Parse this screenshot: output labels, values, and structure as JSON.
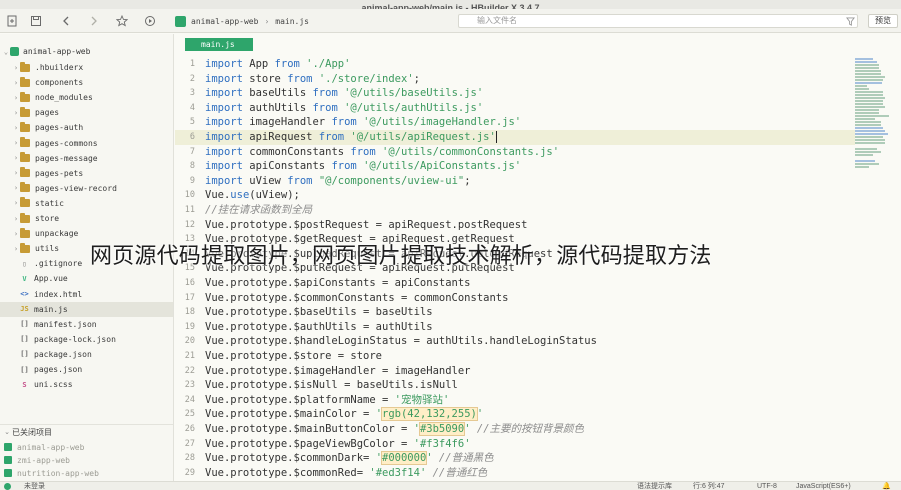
{
  "window": {
    "title": "animal-app-web/main.js - HBuilder X 3.4.7"
  },
  "toolbar": {
    "breadcrumb": [
      "animal-app-web",
      "main.js"
    ],
    "search_placeholder": "输入文件名",
    "preview_label": "预览"
  },
  "sidebar": {
    "project": "animal-app-web",
    "items": [
      {
        "label": ".hbuilderx",
        "type": "folder"
      },
      {
        "label": "components",
        "type": "folder"
      },
      {
        "label": "node_modules",
        "type": "folder"
      },
      {
        "label": "pages",
        "type": "folder"
      },
      {
        "label": "pages-auth",
        "type": "folder"
      },
      {
        "label": "pages-commons",
        "type": "folder"
      },
      {
        "label": "pages-message",
        "type": "folder"
      },
      {
        "label": "pages-pets",
        "type": "folder"
      },
      {
        "label": "pages-view-record",
        "type": "folder"
      },
      {
        "label": "static",
        "type": "folder"
      },
      {
        "label": "store",
        "type": "folder"
      },
      {
        "label": "unpackage",
        "type": "folder"
      },
      {
        "label": "utils",
        "type": "folder"
      },
      {
        "label": ".gitignore",
        "type": "file"
      },
      {
        "label": "App.vue",
        "type": "vue"
      },
      {
        "label": "index.html",
        "type": "html"
      },
      {
        "label": "main.js",
        "type": "js"
      },
      {
        "label": "manifest.json",
        "type": "json"
      },
      {
        "label": "package-lock.json",
        "type": "json"
      },
      {
        "label": "package.json",
        "type": "json"
      },
      {
        "label": "pages.json",
        "type": "json"
      },
      {
        "label": "uni.scss",
        "type": "scss"
      }
    ],
    "closed_header": "已关闭项目",
    "closed_projects": [
      "animal-app-web",
      "zmi-app-web",
      "nutrition-app-web"
    ]
  },
  "editor": {
    "tab": "main.js",
    "current_line": 6,
    "line_numbers": [
      "1",
      "2",
      "3",
      "4",
      "5",
      "6",
      "7",
      "8",
      "9",
      "10",
      "11",
      "12",
      "13",
      "14",
      "15",
      "16",
      "17",
      "18",
      "19",
      "20",
      "21",
      "22",
      "23",
      "24",
      "25",
      "26",
      "27",
      "28",
      "29"
    ]
  },
  "code": {
    "l1": {
      "kw1": "import",
      "name": " App ",
      "kw2": "from",
      "str": " './App'"
    },
    "l2": {
      "kw1": "import",
      "name": " store ",
      "kw2": "from",
      "str": " './store/index'",
      "end": ";"
    },
    "l3": {
      "kw1": "import",
      "name": " baseUtils ",
      "kw2": "from",
      "str": " '@/utils/baseUtils.js'"
    },
    "l4": {
      "kw1": "import",
      "name": " authUtils ",
      "kw2": "from",
      "str": " '@/utils/authUtils.js'"
    },
    "l5": {
      "kw1": "import",
      "name": " imageHandler ",
      "kw2": "from",
      "str": " '@/utils/imageHandler.js'"
    },
    "l6": {
      "kw1": "import",
      "name": " apiRequest ",
      "kw2": "from",
      "str": " '@/utils/apiRequest.js'"
    },
    "l7": {
      "kw1": "import",
      "name": " commonConstants ",
      "kw2": "from",
      "str": " '@/utils/commonConstants.js'"
    },
    "l8": {
      "kw1": "import",
      "name": " apiConstants ",
      "kw2": "from",
      "str": " '@/utils/ApiConstants.js'"
    },
    "l9": {
      "kw1": "import",
      "name": " uView ",
      "kw2": "from",
      "str": " \"@/components/uview-ui\"",
      "end": ";"
    },
    "l10": {
      "a": "Vue.",
      "kw": "use",
      "b": "(uView);"
    },
    "l11": {
      "comment": "//挂在请求函数到全局"
    },
    "l12": {
      "a": "Vue.prototype.$postRequest = apiRequest.postRequest"
    },
    "l13": {
      "a": "Vue.prototype.$getRequest = apiRequest.getRequest"
    },
    "l14": {
      "a": "Vue.prototype.$uploadRequest = apiRequest.uploadRequest"
    },
    "l15": {
      "a": "Vue.prototype.$putRequest = apiRequest.putRequest"
    },
    "l16": {
      "a": "Vue.prototype.$apiConstants = apiConstants"
    },
    "l17": {
      "a": "Vue.prototype.$commonConstants = commonConstants"
    },
    "l18": {
      "a": "Vue.prototype.$baseUtils = baseUtils"
    },
    "l19": {
      "a": "Vue.prototype.$authUtils = authUtils"
    },
    "l20": {
      "a": "Vue.prototype.$handleLoginStatus = authUtils.handleLoginStatus"
    },
    "l21": {
      "a": "Vue.prototype.$store = store"
    },
    "l22": {
      "a": "Vue.prototype.$imageHandler = imageHandler"
    },
    "l23": {
      "a": "Vue.prototype.$isNull = baseUtils.isNull"
    },
    "l24": {
      "a": "Vue.prototype.$platformName = ",
      "str": "'宠物驿站'"
    },
    "l25": {
      "a": "Vue.prototype.$mainColor = ",
      "q1": "'",
      "val": "rgb(42,132,255)",
      "q2": "'"
    },
    "l26": {
      "a": "Vue.prototype.$mainButtonColor = ",
      "q1": "'",
      "val": "#3b5090",
      "q2": "'",
      "comment": " //主要的按钮背景颜色"
    },
    "l27": {
      "a": "Vue.prototype.$pageViewBgColor = ",
      "str": "'#f3f4f6'"
    },
    "l28": {
      "a": "Vue.prototype.$commonDark= ",
      "q1": "'",
      "val": "#000000",
      "q2": "'",
      "comment": " //普通黑色"
    },
    "l29": {
      "a": "Vue.prototype.$commonRed= ",
      "str": "'#ed3f14'",
      "comment": " //普通红色"
    }
  },
  "overlay_text": "网页源代码提取图片，网页图片提取技术解析，源代码提取方法",
  "status": {
    "login": "未登录",
    "hint": "语法提示库",
    "position": "行:6  列:47",
    "encoding": "UTF-8",
    "language": "JavaScript(ES6+)"
  },
  "colors": {
    "accent": "#2ea56b",
    "keyword": "#2f6fc0",
    "string": "#3c9a5f"
  }
}
